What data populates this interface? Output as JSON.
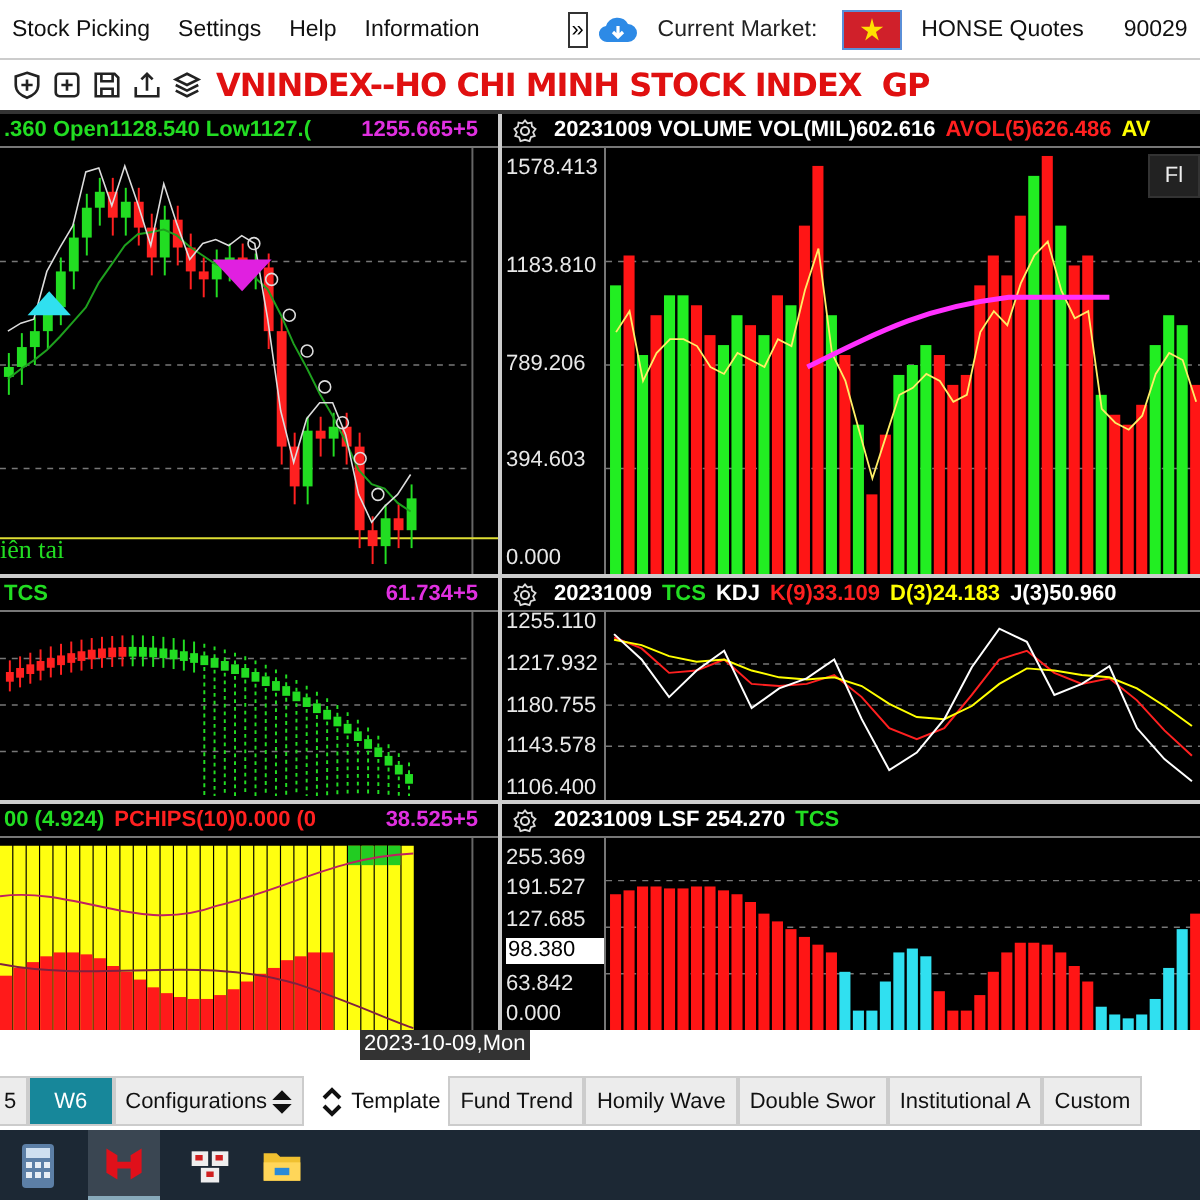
{
  "menu": [
    {
      "label": "Stock Picking"
    },
    {
      "label": "Settings"
    },
    {
      "label": "Help"
    },
    {
      "label": "Information"
    }
  ],
  "overflow_button": "»",
  "market_label": "Current Market:",
  "quotes_label": "HONSE Quotes",
  "account": "90029",
  "title": "VNINDEX--HO CHI MINH STOCK INDEX  GP",
  "price_panel": {
    "header": [
      {
        "text": ".360 Open1128.540 Low1127.(",
        "color": "#22dd22"
      }
    ],
    "value": "1255.665+5",
    "note": "iên tai"
  },
  "volume_panel": {
    "header": [
      {
        "text": "20231009 VOLUME VOL(MIL)602.616",
        "color": "#ffffff"
      },
      {
        "text": "AVOL(5)626.486",
        "color": "#ff2020"
      },
      {
        "text": "AV",
        "color": "#ffff00"
      }
    ],
    "button": "Fl",
    "axis": [
      "1578.413",
      "1183.810",
      "789.206",
      "394.603",
      "0.000"
    ]
  },
  "tcs_panel": {
    "header": [
      {
        "text": "TCS",
        "color": "#22dd22"
      }
    ],
    "value": "61.734+5"
  },
  "kdj_panel": {
    "header": [
      {
        "text": "20231009",
        "color": "#ffffff"
      },
      {
        "text": "TCS",
        "color": "#22dd22"
      },
      {
        "text": "KDJ",
        "color": "#ffffff"
      }
    ],
    "chart_data": {
      "type": "line",
      "grid": true,
      "ylim": [
        1095,
        1265
      ],
      "yticks": [
        {
          "value": 1255.11,
          "label": "1255.110"
        },
        {
          "value": 1217.932,
          "label": "1217.932"
        },
        {
          "value": 1180.755,
          "label": "1180.755"
        },
        {
          "value": 1143.578,
          "label": "1143.578"
        },
        {
          "value": 1106.4,
          "label": "1106.400"
        }
      ],
      "series": [
        {
          "name": "K(9)33.109",
          "color": "#ff2020",
          "values": [
            1242,
            1232,
            1210,
            1212,
            1222,
            1200,
            1198,
            1200,
            1208,
            1188,
            1160,
            1150,
            1160,
            1190,
            1222,
            1230,
            1210,
            1200,
            1205,
            1185,
            1158,
            1135
          ]
        },
        {
          "name": "D(3)24.183",
          "color": "#ffff00",
          "values": [
            1240,
            1235,
            1225,
            1220,
            1222,
            1212,
            1206,
            1204,
            1206,
            1198,
            1182,
            1170,
            1168,
            1180,
            1200,
            1214,
            1212,
            1208,
            1206,
            1196,
            1180,
            1162
          ]
        },
        {
          "name": "J(3)50.960",
          "color": "#ffffff",
          "values": [
            1245,
            1222,
            1188,
            1212,
            1230,
            1178,
            1196,
            1205,
            1222,
            1168,
            1122,
            1138,
            1168,
            1215,
            1250,
            1238,
            1190,
            1200,
            1216,
            1160,
            1132,
            1112
          ]
        }
      ]
    }
  },
  "pchips_panel": {
    "header": [
      {
        "text": "00 (4.924)",
        "color": "#22dd22"
      },
      {
        "text": "PCHIPS(10)0.000 (0",
        "color": "#ff2020"
      }
    ],
    "value": "38.525+5"
  },
  "lsf_panel": {
    "header": [
      {
        "text": "20231009 LSF 254.270",
        "color": "#ffffff"
      },
      {
        "text": "TCS",
        "color": "#22dd22"
      }
    ],
    "axis": [
      {
        "text": "255.369",
        "kind": "tick"
      },
      {
        "text": "191.527",
        "kind": "tick"
      },
      {
        "text": "127.685",
        "kind": "tick"
      },
      {
        "text": "98.380",
        "kind": "cursor"
      },
      {
        "text": "63.842",
        "kind": "tick"
      },
      {
        "text": "0.000",
        "kind": "tick"
      }
    ]
  },
  "date_tooltip": "2023-10-09,Mon",
  "tabs": [
    {
      "label": "5",
      "kind": "tab",
      "selected": false
    },
    {
      "label": "W6",
      "kind": "tab",
      "selected": true
    },
    {
      "label": "Configurations",
      "kind": "spinner",
      "selected": false
    },
    {
      "label": "Template",
      "kind": "plain",
      "selected": false
    },
    {
      "label": "Fund Trend",
      "kind": "tab",
      "selected": false
    },
    {
      "label": "Homily Wave",
      "kind": "tab",
      "selected": false
    },
    {
      "label": "Double Swor",
      "kind": "tab",
      "selected": false
    },
    {
      "label": "Institutional A",
      "kind": "tab",
      "selected": false
    },
    {
      "label": "Custom",
      "kind": "tab",
      "selected": false
    }
  ]
}
